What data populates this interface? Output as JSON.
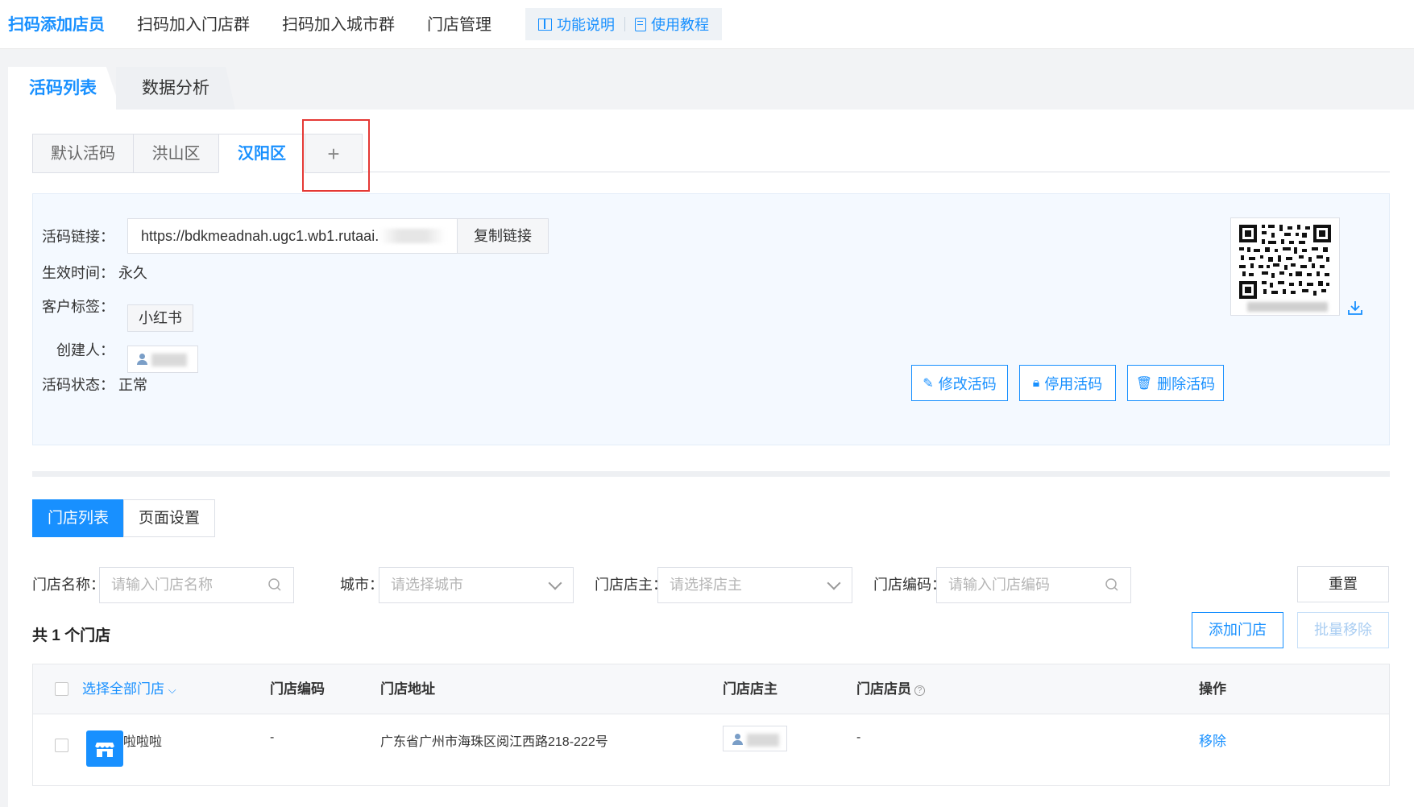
{
  "topnav": {
    "items": [
      "扫码添加店员",
      "扫码加入门店群",
      "扫码加入城市群",
      "门店管理"
    ],
    "help": [
      "功能说明",
      "使用教程"
    ]
  },
  "subtabs": [
    "活码列表",
    "数据分析"
  ],
  "code_tabs": [
    "默认活码",
    "洪山区",
    "汉阳区",
    "+"
  ],
  "info": {
    "link_label": "活码链接：",
    "link_value": "https://bdkmeadnah.ugc1.wb1.rutaai.",
    "copy_label": "复制链接",
    "effective_label": "生效时间：",
    "effective_value": "永久",
    "tag_label": "客户标签：",
    "tag_value": "小红书",
    "creator_label": "创建人：",
    "status_label": "活码状态：",
    "status_value": "正常",
    "buttons": [
      "修改活码",
      "停用活码",
      "删除活码"
    ]
  },
  "store_tabs": [
    "门店列表",
    "页面设置"
  ],
  "filters": {
    "name_label": "门店名称：",
    "name_placeholder": "请输入门店名称",
    "city_label": "城市：",
    "city_placeholder": "请选择城市",
    "owner_label": "门店店主：",
    "owner_placeholder": "请选择店主",
    "code_label": "门店编码：",
    "code_placeholder": "请输入门店编码",
    "reset": "重置"
  },
  "count_text": "共 1 个门店",
  "actions": {
    "add": "添加门店",
    "batch_remove": "批量移除"
  },
  "table": {
    "headers": {
      "select_all": "选择全部门店",
      "code": "门店编码",
      "address": "门店地址",
      "owner": "门店店主",
      "staff": "门店店员",
      "ops": "操作"
    },
    "rows": [
      {
        "name": "啦啦啦",
        "code": "-",
        "address": "广东省广州市海珠区阅江西路218-222号",
        "staff": "-",
        "op": "移除"
      }
    ]
  },
  "colors": {
    "accent": "#1890ff",
    "highlight": "#e53935"
  }
}
